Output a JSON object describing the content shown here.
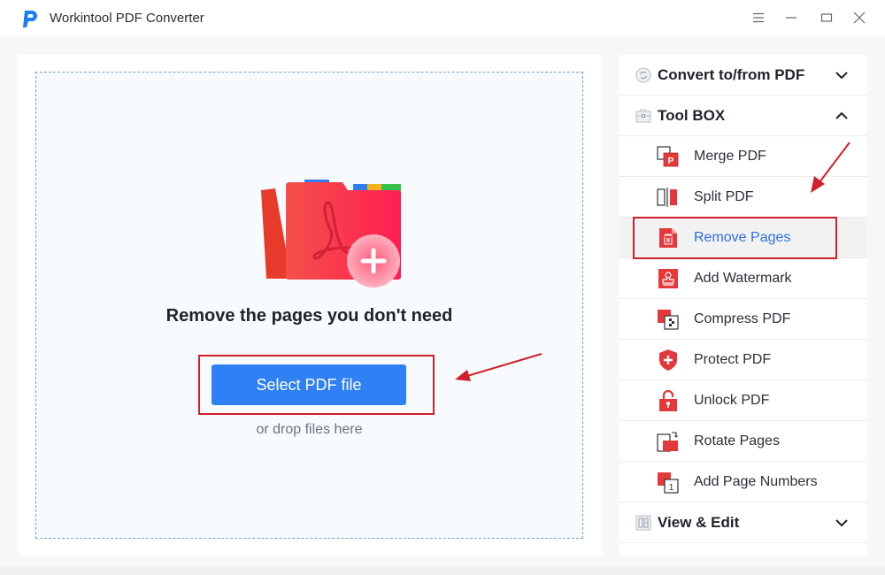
{
  "window": {
    "title": "Workintool PDF Converter",
    "controls": [
      {
        "name": "menu",
        "icon": "hamburger-menu-icon"
      },
      {
        "name": "minimize",
        "icon": "minimize-icon"
      },
      {
        "name": "maximize",
        "icon": "maximize-icon"
      },
      {
        "name": "close",
        "icon": "close-icon"
      }
    ]
  },
  "main": {
    "headline": "Remove the pages you don't need",
    "select_button": "Select PDF file",
    "drop_hint": "or drop files here",
    "illustration": "pdf-folder-add-icon",
    "button_color": "#2f80f5"
  },
  "sidebar": {
    "sections": [
      {
        "label": "Convert to/from PDF",
        "icon": "convert-icon",
        "expanded": false
      },
      {
        "label": "Tool BOX",
        "icon": "toolbox-icon",
        "expanded": true
      },
      {
        "label": "View & Edit",
        "icon": "view-edit-icon",
        "expanded": false
      }
    ],
    "tools": [
      {
        "label": "Merge PDF",
        "icon": "merge-pdf-icon"
      },
      {
        "label": "Split PDF",
        "icon": "split-pdf-icon"
      },
      {
        "label": "Remove Pages",
        "icon": "remove-pages-icon",
        "active": true
      },
      {
        "label": "Add Watermark",
        "icon": "watermark-icon"
      },
      {
        "label": "Compress PDF",
        "icon": "compress-pdf-icon"
      },
      {
        "label": "Protect PDF",
        "icon": "protect-pdf-icon"
      },
      {
        "label": "Unlock PDF",
        "icon": "unlock-pdf-icon"
      },
      {
        "label": "Rotate Pages",
        "icon": "rotate-pages-icon"
      },
      {
        "label": "Add Page Numbers",
        "icon": "page-numbers-icon"
      }
    ],
    "active_color": "#2f6fdc",
    "icon_red": "#e5383b"
  },
  "annotations": {
    "highlight_color": "#d0202a"
  }
}
